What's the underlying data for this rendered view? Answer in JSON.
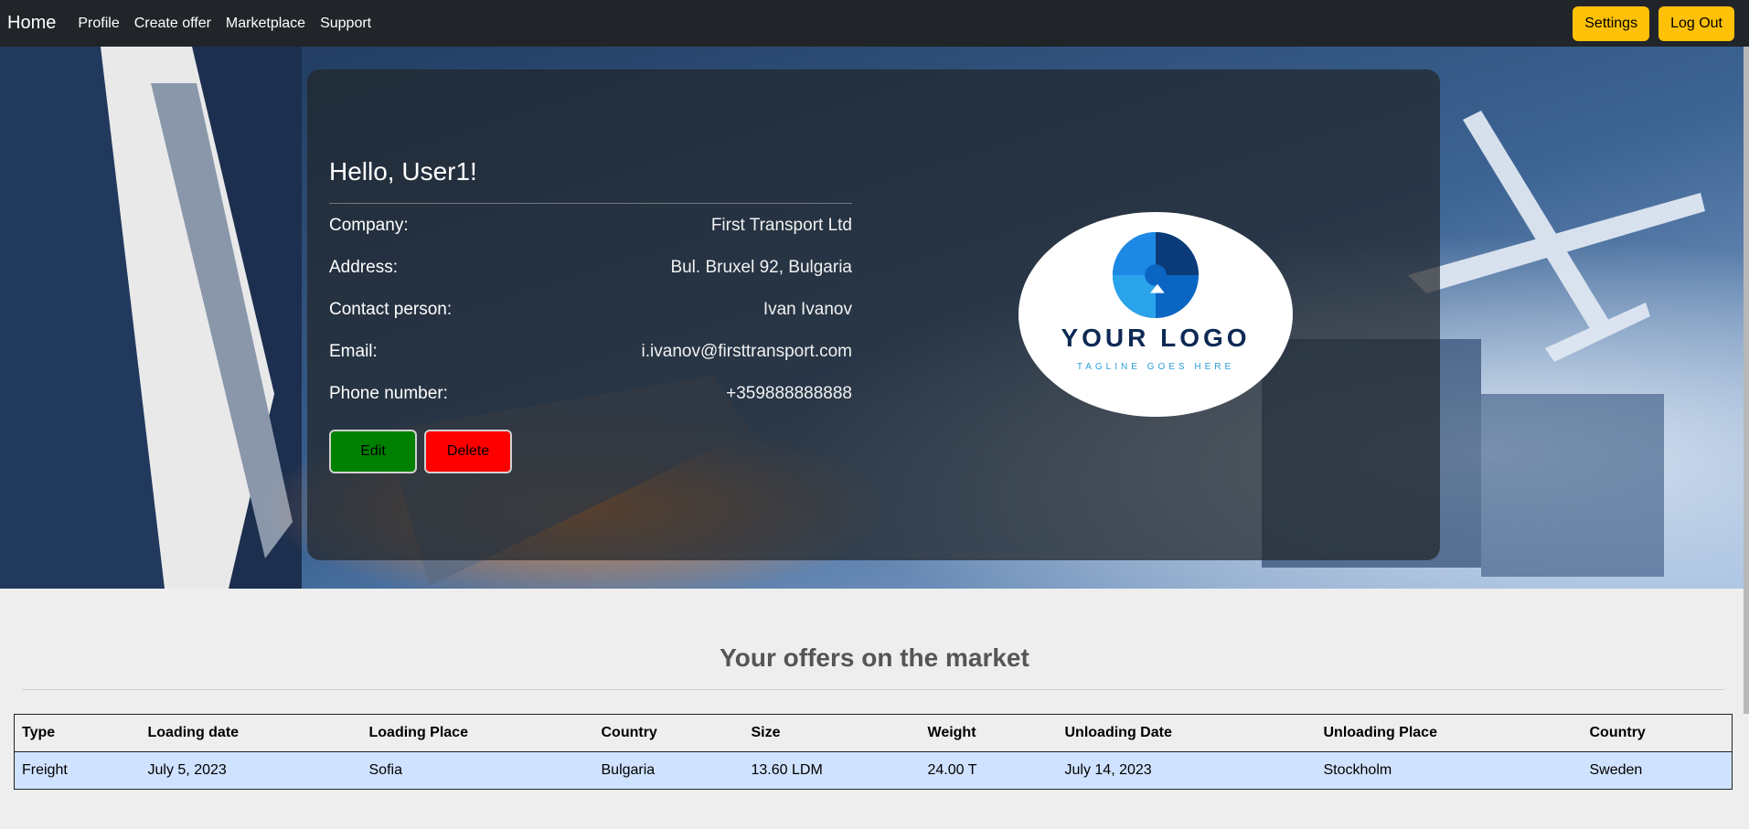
{
  "navbar": {
    "brand": "Home",
    "links": [
      "Profile",
      "Create offer",
      "Marketplace",
      "Support"
    ],
    "settings_label": "Settings",
    "logout_label": "Log Out"
  },
  "profile": {
    "greeting": "Hello, User1!",
    "fields": [
      {
        "label": "Company:",
        "value": "First Transport Ltd"
      },
      {
        "label": "Address:",
        "value": "Bul. Bruxel 92, Bulgaria"
      },
      {
        "label": "Contact person:",
        "value": "Ivan Ivanov"
      },
      {
        "label": "Email:",
        "value": "i.ivanov@firsttransport.com"
      },
      {
        "label": "Phone number:",
        "value": "+359888888888"
      }
    ],
    "edit_label": "Edit",
    "delete_label": "Delete",
    "logo": {
      "text": "YOUR LOGO",
      "tagline": "TAGLINE GOES HERE"
    }
  },
  "offers": {
    "title": "Your offers on the market",
    "columns": [
      "Type",
      "Loading date",
      "Loading Place",
      "Country",
      "Size",
      "Weight",
      "Unloading Date",
      "Unloading Place",
      "Country"
    ],
    "rows": [
      [
        "Freight",
        "July 5, 2023",
        "Sofia",
        "Bulgaria",
        "13.60 LDM",
        "24.00 T",
        "July 14, 2023",
        "Stockholm",
        "Sweden"
      ]
    ]
  },
  "colors": {
    "navbar_bg": "#212529",
    "accent_warning": "#ffc107",
    "edit_button": "#008000",
    "delete_button": "#ff0000",
    "row_highlight": "#cfe2ff"
  }
}
